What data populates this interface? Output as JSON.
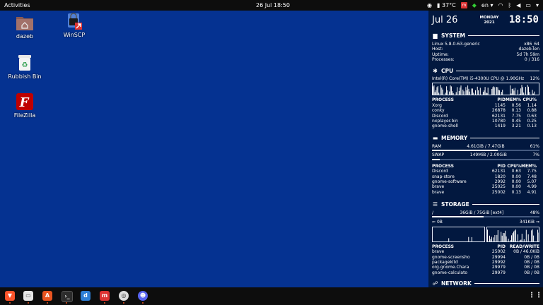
{
  "topbar": {
    "activities": "Activities",
    "clock": "26 Jul  18:50",
    "temperature": "37°C",
    "keyboard": "en"
  },
  "desktop": {
    "icons": [
      {
        "label": "dazeb",
        "icon": "home-folder-icon"
      },
      {
        "label": "WinSCP",
        "icon": "winscp-icon"
      },
      {
        "label": "Rubbish Bin",
        "icon": "rubbish-bin-icon"
      },
      {
        "label": "FileZilla",
        "icon": "filezilla-icon"
      }
    ]
  },
  "conky": {
    "date": "Jul 26",
    "weekday": "MONDAY",
    "year": "2021",
    "time": "18:50",
    "system": {
      "title": "SYSTEM",
      "os": "Linux 5.8.0-63-generic",
      "arch": "x86_64",
      "host_label": "Host:",
      "host": "dazeb-len",
      "uptime_label": "Uptime:",
      "uptime": "5d 7h 59m",
      "processes_label": "Processes:",
      "processes": "0 / 316"
    },
    "cpu": {
      "title": "CPU",
      "model": "Intel(R) Core(TM) i5-4300U CPU @ 1.90GHz",
      "usage": "12%",
      "headers": [
        "PROCESS",
        "PID",
        "MEM%",
        "CPU%"
      ],
      "rows": [
        [
          "Xorg",
          "1145",
          "0.56",
          "1.14"
        ],
        [
          "conky",
          "26878",
          "0.13",
          "0.88"
        ],
        [
          "Discord",
          "62131",
          "7.75",
          "0.63"
        ],
        [
          "nxplayer.bin",
          "10780",
          "0.45",
          "0.25"
        ],
        [
          "gnome-shell",
          "1419",
          "3.21",
          "0.13"
        ]
      ]
    },
    "memory": {
      "title": "MEMORY",
      "ram_label": "RAM",
      "ram_value": "4.61GiB / 7.47GiB",
      "ram_pct": "61%",
      "ram_fraction": 0.61,
      "swap_label": "SWAP",
      "swap_value": "149MiB / 2.00GiB",
      "swap_pct": "7%",
      "swap_fraction": 0.07,
      "headers": [
        "PROCESS",
        "PID",
        "CPU%",
        "MEM%"
      ],
      "rows": [
        [
          "Discord",
          "62131",
          "0.63",
          "7.75"
        ],
        [
          "snap-store",
          "1820",
          "0.00",
          "7.48"
        ],
        [
          "gnome-software",
          "2992",
          "0.00",
          "5.07"
        ],
        [
          "brave",
          "25025",
          "0.00",
          "4.99"
        ],
        [
          "brave",
          "25002",
          "0.13",
          "4.91"
        ]
      ]
    },
    "storage": {
      "title": "STORAGE",
      "mount": "/",
      "usage": "36GiB / 75GiB [ext4]",
      "pct": "48%",
      "fraction": 0.48,
      "read": "0B",
      "write": "341KiB",
      "headers": [
        "PROCESS",
        "PID",
        "READ/WRITE"
      ],
      "rows": [
        [
          "brave",
          "25002",
          "0B / 46.0KiB"
        ],
        [
          "gnome-screensho",
          "29994",
          "0B / 0B"
        ],
        [
          "packagekitd",
          "29992",
          "0B / 0B"
        ],
        [
          "org.gnome.Chara",
          "29979",
          "0B / 0B"
        ],
        [
          "gnome-calculato",
          "29979",
          "0B / 0B"
        ]
      ]
    },
    "network": {
      "title": "NETWORK"
    }
  },
  "dock": {
    "apps": [
      "brave-icon",
      "files-icon",
      "app-store-icon",
      "terminal-icon",
      "dictionary-icon",
      "calculator-icon",
      "settings-icon",
      "discord-icon"
    ],
    "show_apps": "show-applications-icon"
  },
  "colors": {
    "desktop": "#053291",
    "conky_bg": "#02183f",
    "accent": "#e95420"
  }
}
